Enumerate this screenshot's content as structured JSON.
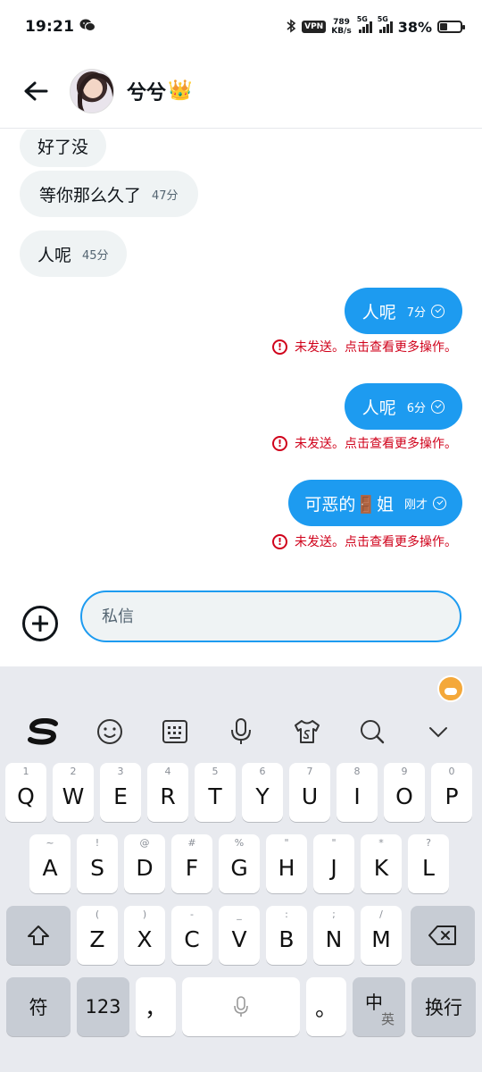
{
  "status_bar": {
    "time": "19:21",
    "vpn": "VPN",
    "net_speed_value": "789",
    "net_speed_unit": "KB/s",
    "signal1_label": "5G",
    "signal2_label": "5G",
    "battery_percent": "38%",
    "battery_level": 0.38
  },
  "header": {
    "contact_name": "兮兮",
    "crown": "👑"
  },
  "messages": [
    {
      "dir": "in",
      "text": "好了没",
      "time": ""
    },
    {
      "dir": "in",
      "text": "等你那么久了",
      "time": "47分"
    },
    {
      "dir": "in",
      "text": "人呢",
      "time": "45分"
    },
    {
      "dir": "out",
      "text": "人呢",
      "time": "7分",
      "error": "未发送。点击查看更多操作。"
    },
    {
      "dir": "out",
      "text": "人呢",
      "time": "6分",
      "error": "未发送。点击查看更多操作。"
    },
    {
      "dir": "out",
      "text": "可恶的🚪姐",
      "time": "刚才",
      "error": "未发送。点击查看更多操作。"
    }
  ],
  "composer": {
    "placeholder": "私信"
  },
  "keyboard": {
    "row1": [
      {
        "hint": "1",
        "key": "Q"
      },
      {
        "hint": "2",
        "key": "W"
      },
      {
        "hint": "3",
        "key": "E"
      },
      {
        "hint": "4",
        "key": "R"
      },
      {
        "hint": "5",
        "key": "T"
      },
      {
        "hint": "6",
        "key": "Y"
      },
      {
        "hint": "7",
        "key": "U"
      },
      {
        "hint": "8",
        "key": "I"
      },
      {
        "hint": "9",
        "key": "O"
      },
      {
        "hint": "0",
        "key": "P"
      }
    ],
    "row2": [
      {
        "hint": "~",
        "key": "A"
      },
      {
        "hint": "!",
        "key": "S"
      },
      {
        "hint": "@",
        "key": "D"
      },
      {
        "hint": "#",
        "key": "F"
      },
      {
        "hint": "%",
        "key": "G"
      },
      {
        "hint": "\"",
        "key": "H"
      },
      {
        "hint": "\"",
        "key": "J"
      },
      {
        "hint": "*",
        "key": "K"
      },
      {
        "hint": "?",
        "key": "L"
      }
    ],
    "row3": [
      {
        "hint": "(",
        "key": "Z"
      },
      {
        "hint": ")",
        "key": "X"
      },
      {
        "hint": "-",
        "key": "C"
      },
      {
        "hint": "_",
        "key": "V"
      },
      {
        "hint": ":",
        "key": "B"
      },
      {
        "hint": ";",
        "key": "N"
      },
      {
        "hint": "/",
        "key": "M"
      }
    ],
    "symbols_key": "符",
    "numbers_key": "123",
    "comma_key": "，",
    "period_key": "。",
    "lang_zh": "中",
    "lang_en": "英",
    "enter_key": "换行"
  }
}
